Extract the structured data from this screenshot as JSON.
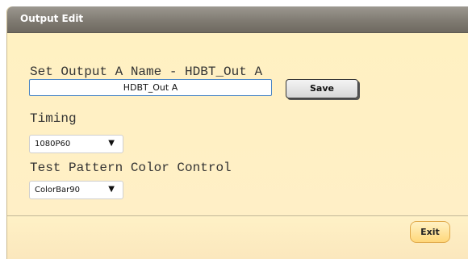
{
  "dialog": {
    "title": "Output Edit"
  },
  "name_section": {
    "label": "Set Output A Name - HDBT_Out A",
    "input_value": "HDBT_Out A",
    "save_label": "Save"
  },
  "timing": {
    "label": "Timing",
    "selected": "1080P60",
    "caret": "▼"
  },
  "test_pattern": {
    "label": "Test Pattern Color Control",
    "selected": "ColorBar90",
    "caret": "▼"
  },
  "footer": {
    "exit_label": "Exit"
  },
  "colors": {
    "panel_background": "#fff2c8",
    "title_bar": "#807b72",
    "input_border": "#4a86c5",
    "exit_button": "#ffd77a"
  },
  "icons": {
    "dropdown_caret": "chevron-down-icon"
  }
}
